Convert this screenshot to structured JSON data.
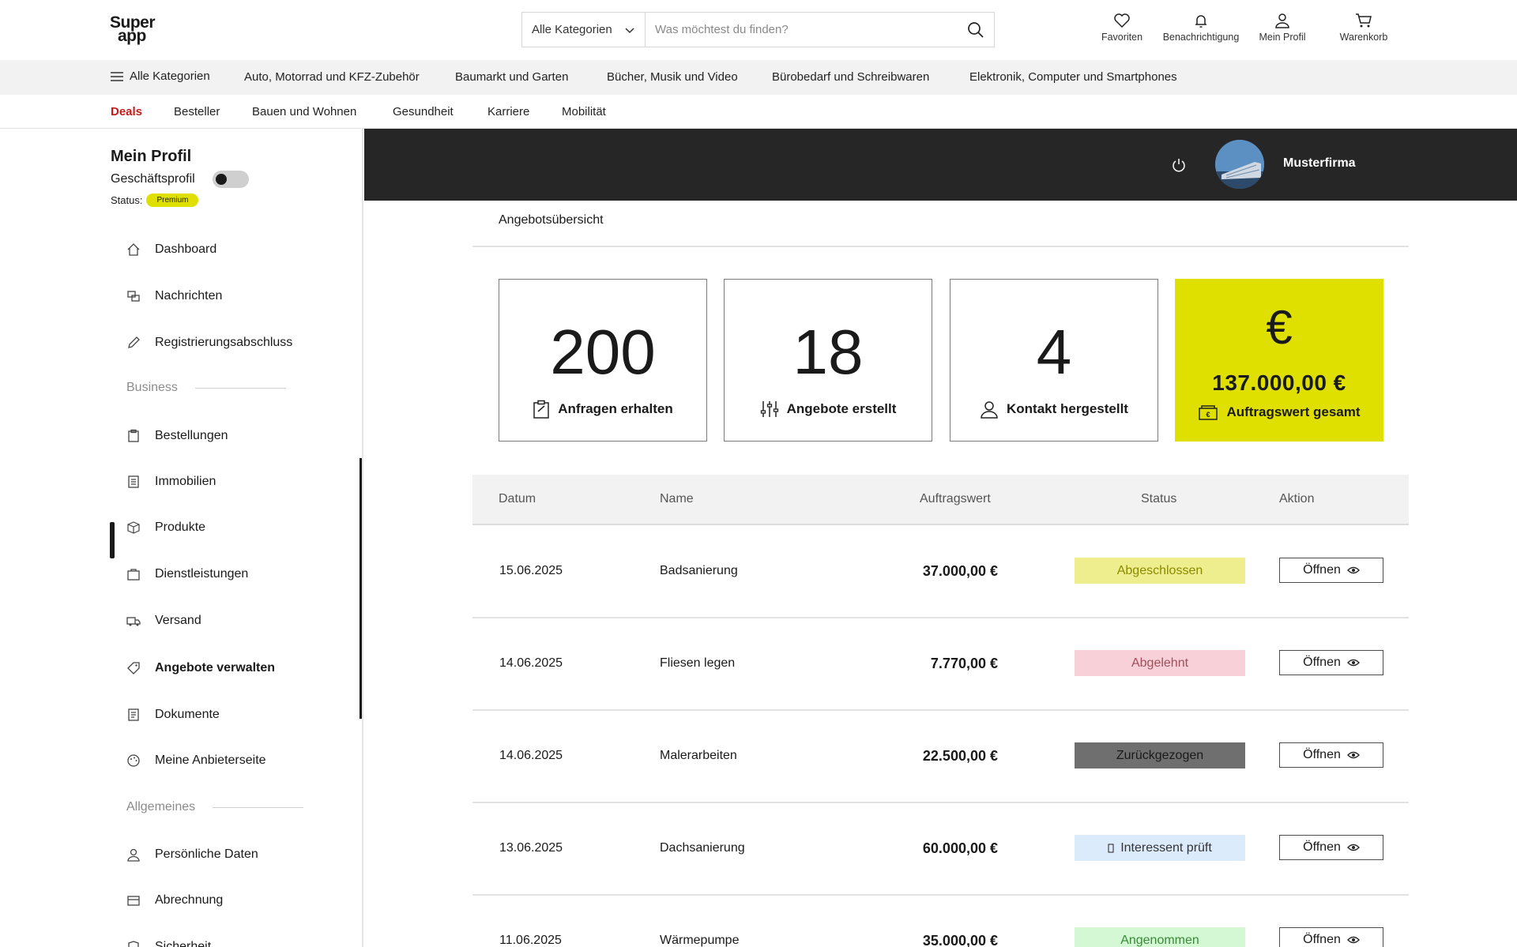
{
  "header": {
    "logo_line1": "Super",
    "logo_line2": "app",
    "search_category": "Alle Kategorien",
    "search_placeholder": "Was möchtest du finden?",
    "icons": [
      {
        "label": "Favoriten",
        "icon": "heart-icon"
      },
      {
        "label": "Benachrichtigung",
        "icon": "bell-icon"
      },
      {
        "label": "Mein Profil",
        "icon": "user-icon"
      },
      {
        "label": "Warenkorb",
        "icon": "cart-icon"
      }
    ]
  },
  "category_bar": {
    "all_label": "Alle Kategorien",
    "items": [
      "Auto, Motorrad und KFZ-Zubehör",
      "Baumarkt und Garten",
      "Bücher, Musik und Video",
      "Bürobedarf und Schreibwaren",
      "Elektronik, Computer und Smartphones"
    ]
  },
  "sub_bar": {
    "items": [
      "Deals",
      "Besteller",
      "Bauen und Wohnen",
      "Gesundheit",
      "Karriere",
      "Mobilität"
    ]
  },
  "sidebar": {
    "title": "Mein Profil",
    "business_label": "Geschäftsprofil",
    "status_label": "Status:",
    "status_badge": "Premium",
    "items": [
      {
        "label": "Dashboard",
        "icon": "home-icon"
      },
      {
        "label": "Nachrichten",
        "icon": "messages-icon"
      },
      {
        "label": "Registrierungsabschluss",
        "icon": "pen-icon"
      },
      {
        "label": "Bestellungen",
        "icon": "clipboard-icon"
      },
      {
        "label": "Immobilien",
        "icon": "building-icon"
      },
      {
        "label": "Produkte",
        "icon": "box-icon"
      },
      {
        "label": "Dienstleistungen",
        "icon": "briefcase-icon"
      },
      {
        "label": "Versand",
        "icon": "truck-icon"
      },
      {
        "label": "Angebote verwalten",
        "icon": "tag-icon"
      },
      {
        "label": "Dokumente",
        "icon": "document-icon"
      },
      {
        "label": "Meine Anbieterseite",
        "icon": "palette-icon"
      },
      {
        "label": "Persönliche Daten",
        "icon": "user-icon"
      },
      {
        "label": "Abrechnung",
        "icon": "billing-icon"
      },
      {
        "label": "Sicherheit",
        "icon": "shield-icon"
      }
    ],
    "sections": [
      "Business",
      "Allgemeines"
    ],
    "active_item": "Angebote verwalten"
  },
  "topbar": {
    "company": "Musterfirma",
    "power_icon": "power-icon"
  },
  "main": {
    "subtitle": "Angebotsübersicht",
    "stats": [
      {
        "value": "200",
        "label": "Anfragen erhalten",
        "icon": "clipboard-check-icon"
      },
      {
        "value": "18",
        "label": "Angebote erstellt",
        "icon": "sliders-icon"
      },
      {
        "value": "4",
        "label": "Kontakt hergestellt",
        "icon": "user-icon"
      },
      {
        "value": "137.000,00 €",
        "symbol": "€",
        "label": "Auftragswert gesamt",
        "icon": "cash-icon"
      }
    ],
    "table": {
      "headers": [
        "Datum",
        "Name",
        "Auftragswert",
        "Status",
        "Aktion"
      ],
      "rows": [
        {
          "date": "15.06.2025",
          "name": "Badsanierung",
          "value": "37.000,00 €",
          "status": "Abgeschlossen",
          "status_bg": "#eeee8e",
          "status_fg": "#8a8a00",
          "action": "Öffnen"
        },
        {
          "date": "14.06.2025",
          "name": "Fliesen legen",
          "value": "7.770,00 €",
          "status": "Abgelehnt",
          "status_bg": "#f8d1d8",
          "status_fg": "#9e4f5c",
          "action": "Öffnen"
        },
        {
          "date": "14.06.2025",
          "name": "Malerarbeiten",
          "value": "22.500,00 €",
          "status": "Zurückgezogen",
          "status_bg": "#6f6f6f",
          "status_fg": "#1a1a1a",
          "action": "Öffnen"
        },
        {
          "date": "13.06.2025",
          "name": "Dachsanierung",
          "value": "60.000,00 €",
          "status": "Interessent prüft",
          "status_bg": "#dcebfb",
          "status_fg": "#333333",
          "action": "Öffnen"
        },
        {
          "date": "11.06.2025",
          "name": "Wärmepumpe",
          "value": "35.000,00 €",
          "status": "Angenommen",
          "status_bg": "#d3f8d3",
          "status_fg": "#3a8a3a",
          "action": "Öffnen"
        }
      ]
    }
  },
  "colors": {
    "accent_yellow": "#dfe000",
    "deals_red": "#c41a1a",
    "dark_bar": "#262626"
  }
}
